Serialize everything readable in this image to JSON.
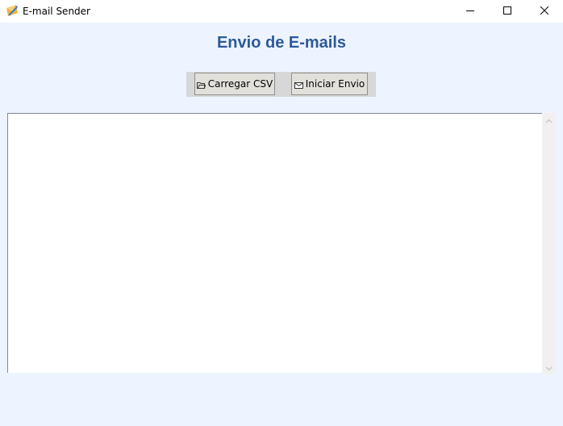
{
  "window": {
    "title": "E-mail Sender",
    "app_icon": "envelope-icon",
    "controls": [
      "minimize-icon",
      "maximize-icon",
      "close-icon"
    ]
  },
  "main": {
    "heading": "Envio de E-mails",
    "buttons": {
      "load_csv": {
        "label": "Carregar CSV",
        "icon": "folder-icon"
      },
      "start_send": {
        "label": "Iniciar Envio",
        "icon": "envelope-icon"
      }
    },
    "log_text": ""
  },
  "colors": {
    "background": "#eef4ff",
    "heading": "#2c5a9a",
    "button_bar": "#d7d7d7",
    "button": "#e2e0db"
  }
}
